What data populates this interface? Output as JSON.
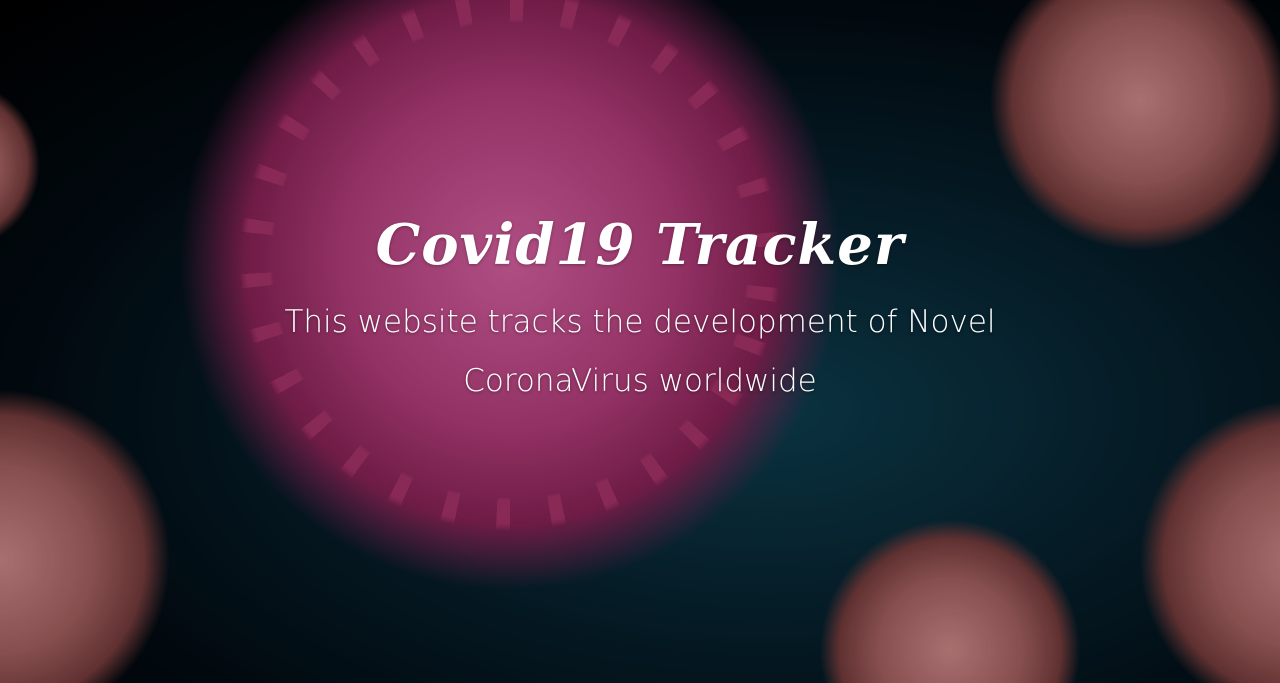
{
  "hero": {
    "title": "Covid19 Tracker",
    "subtitle": "This website tracks the development of Novel CoronaVirus worldwide"
  },
  "colors": {
    "text": "#ffffff",
    "background": "#06202c",
    "virus_main": "#a83a74",
    "virus_secondary": "#9a5a5a"
  }
}
